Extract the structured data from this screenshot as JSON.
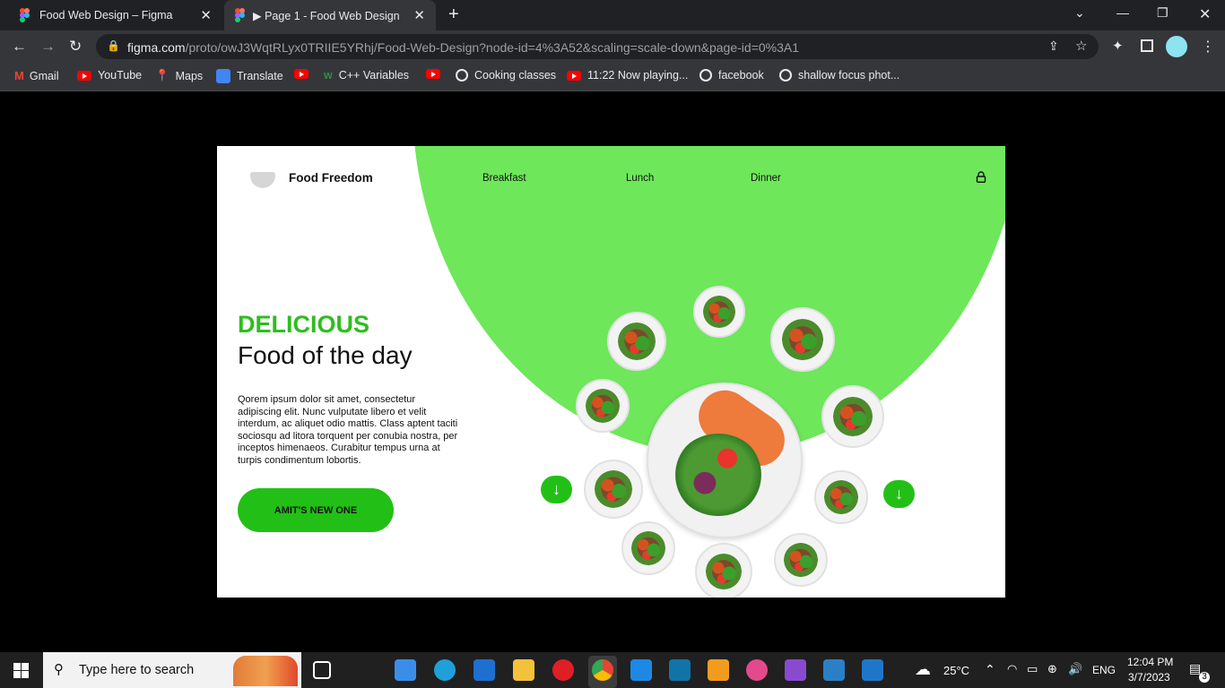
{
  "browser": {
    "tabs": [
      {
        "title": "Food Web Design – Figma"
      },
      {
        "title": "▶ Page 1 - Food Web Design"
      }
    ],
    "url_domain": "figma.com",
    "url_path": "/proto/owJ3WqtRLyx0TRIIE5YRhj/Food-Web-Design?node-id=4%3A52&scaling=scale-down&page-id=0%3A1",
    "bookmarks": [
      "Gmail",
      "YouTube",
      "Maps",
      "Translate",
      "C++ Variables",
      "Cooking classes",
      "11:22 Now playing...",
      "facebook",
      "shallow focus phot..."
    ]
  },
  "site": {
    "brand": "Food Freedom",
    "nav": [
      "Breakfast",
      "Lunch",
      "Dinner"
    ],
    "headline_accent": "DELICIOUS",
    "headline": "Food of the day",
    "description": "Qorem ipsum dolor sit amet, consectetur adipiscing elit. Nunc vulputate libero et velit interdum, ac aliquet odio mattis. Class aptent taciti sociosqu ad litora torquent per conubia nostra, per inceptos himenaeos. Curabitur tempus urna at turpis condimentum lobortis.",
    "cta_label": "AMIT'S NEW ONE",
    "accent_color": "#6ee75a",
    "button_color": "#22c016"
  },
  "taskbar": {
    "search_placeholder": "Type here to search",
    "weather": "25°C",
    "language": "ENG",
    "time": "12:04 PM",
    "date": "3/7/2023",
    "notifications": "3"
  }
}
